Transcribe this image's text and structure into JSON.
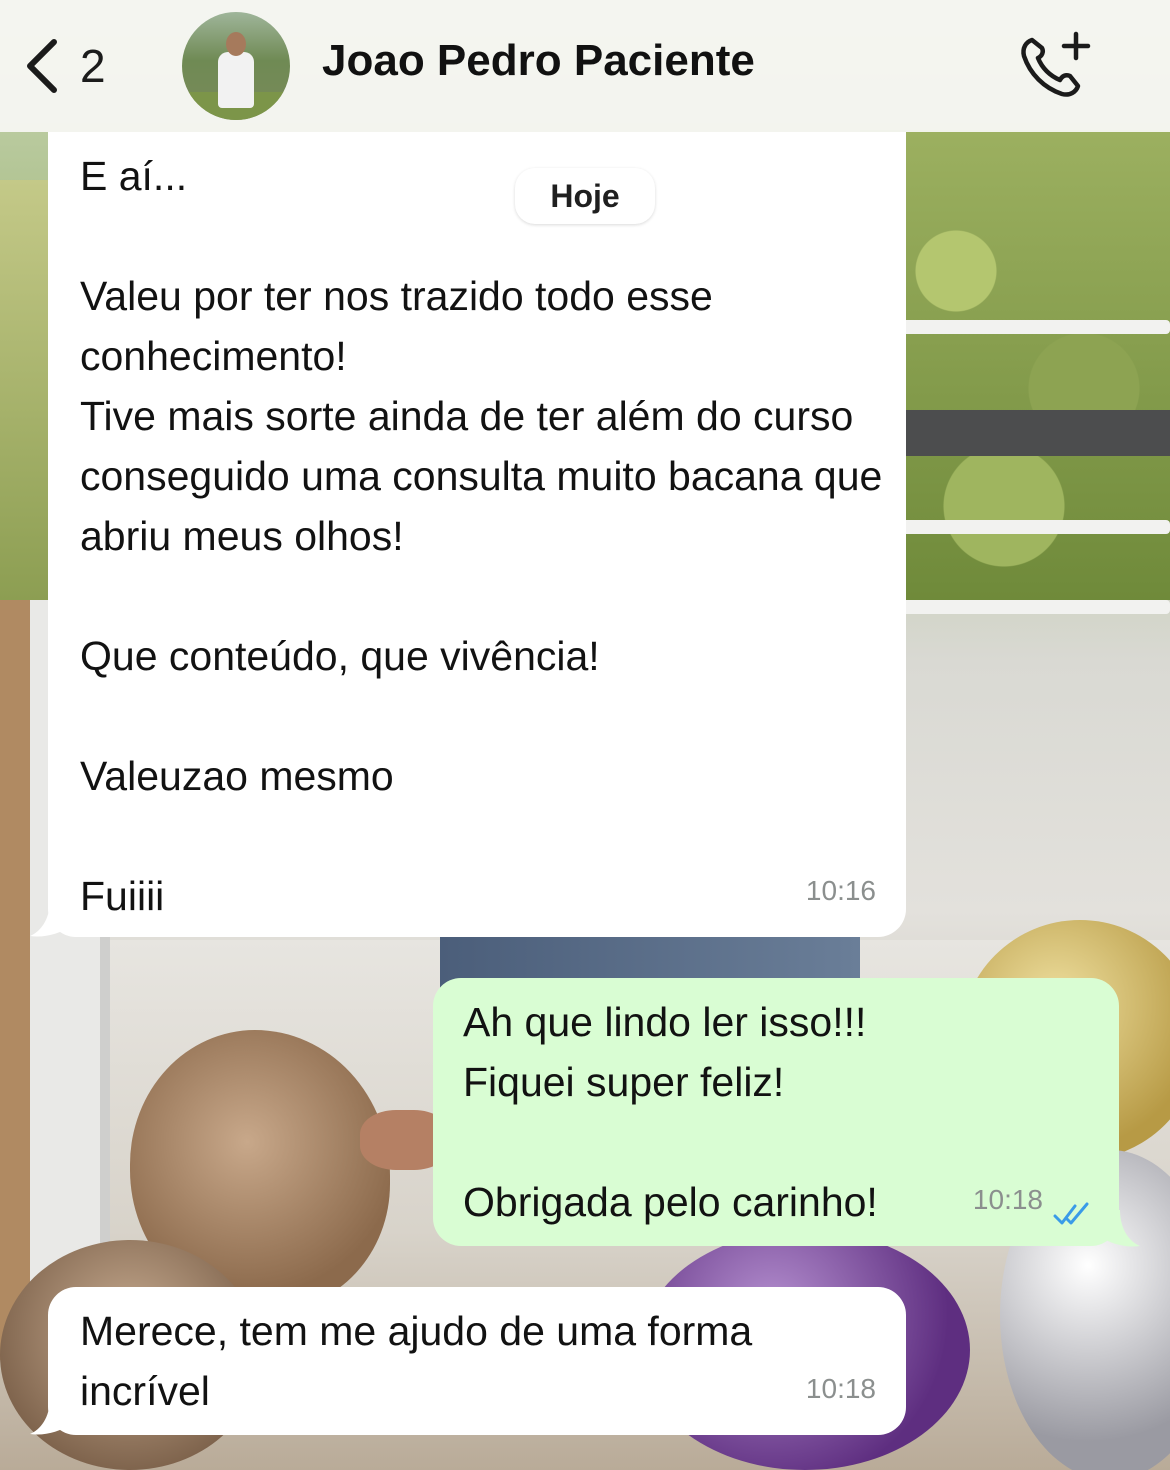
{
  "header": {
    "back_count": "2",
    "contact_name": "Joao Pedro Paciente",
    "icons": [
      "chevron-left-icon",
      "add-call-icon"
    ]
  },
  "date_separator": "Hoje",
  "messages": [
    {
      "direction": "incoming",
      "text": "E aí...\n\nValeu por ter nos trazido todo esse conhecimento!\nTive mais sorte ainda de ter além do curso conseguido uma consulta muito bacana que abriu meus olhos!\n\nQue conteúdo, que vivência!\n\nValeuzao mesmo\n\nFuiiii",
      "time": "10:16"
    },
    {
      "direction": "outgoing",
      "text": "Ah que lindo ler isso!!!\nFiquei super feliz!\n\nObrigada pelo carinho!",
      "time": "10:18",
      "status": "read"
    },
    {
      "direction": "incoming",
      "text": "Merece, tem me ajudo de uma forma incrível",
      "time": "10:18"
    }
  ],
  "colors": {
    "incoming_bubble": "#ffffff",
    "outgoing_bubble": "#d9fdd3",
    "read_ticks": "#3a9be8"
  }
}
